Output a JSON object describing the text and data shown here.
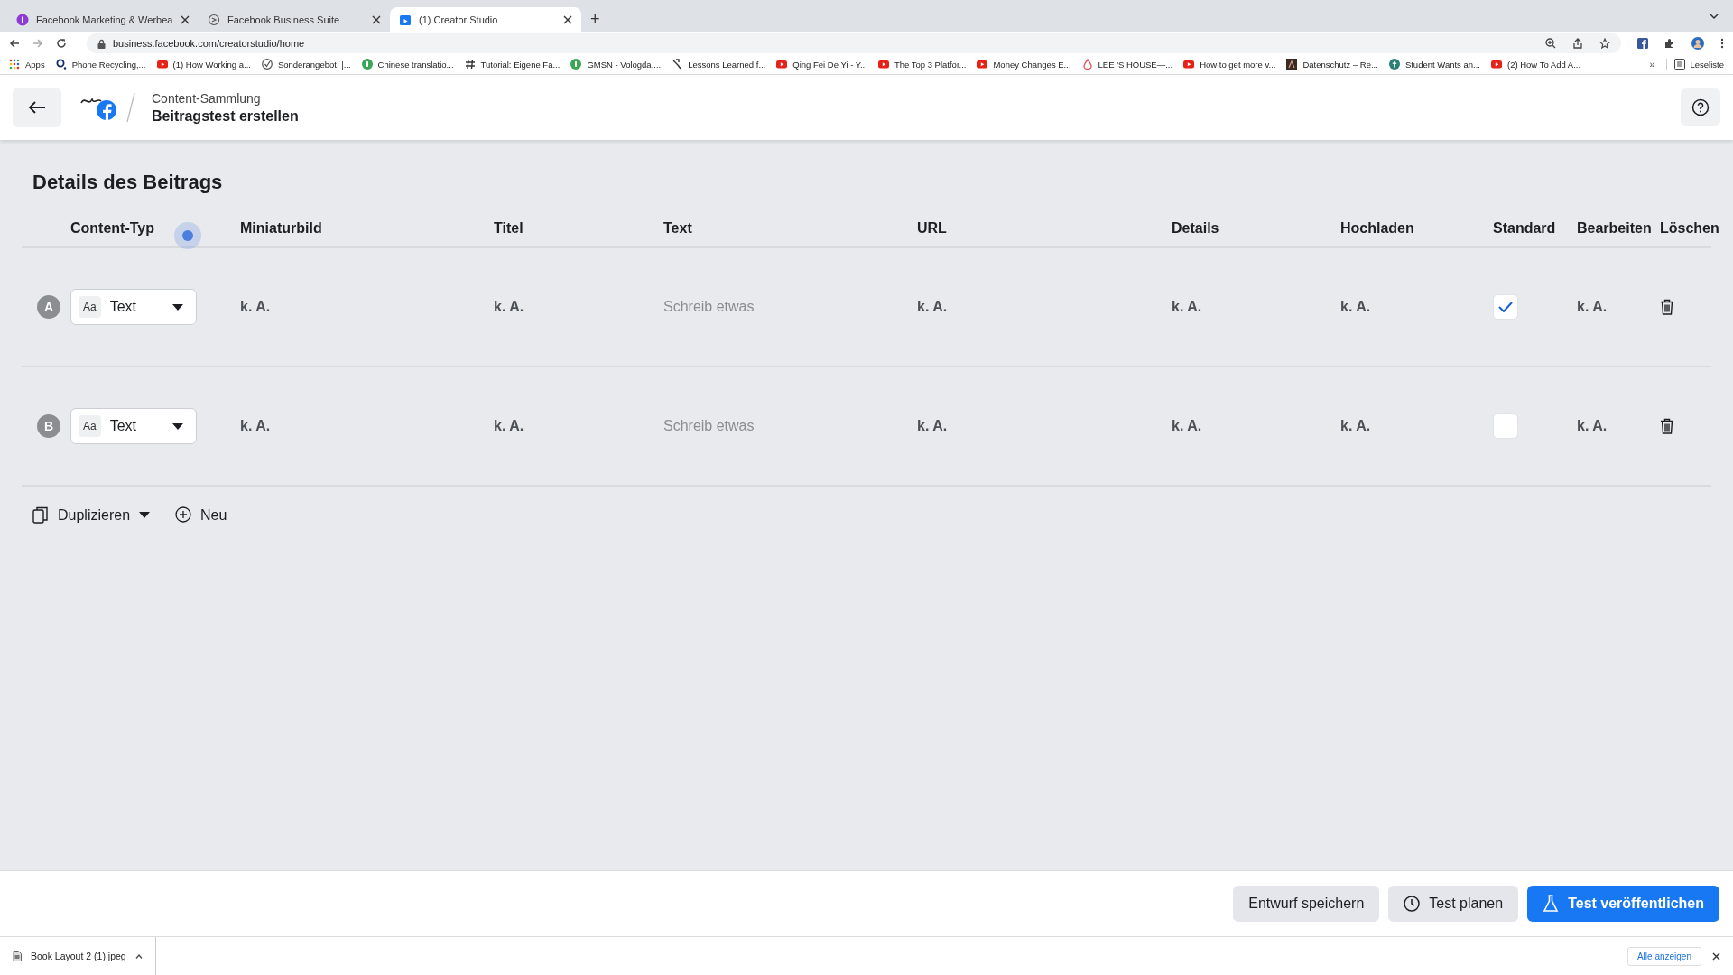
{
  "browser": {
    "tabs": [
      {
        "title": "Facebook Marketing & Werbea",
        "selected": false,
        "kind": "purple"
      },
      {
        "title": "Facebook Business Suite",
        "selected": false,
        "kind": "suite"
      },
      {
        "title": "(1) Creator Studio",
        "selected": true,
        "kind": "studio"
      }
    ],
    "new_tab": "+",
    "address": "business.facebook.com/creatorstudio/home",
    "bookmarks": [
      {
        "title": "Apps",
        "kind": "apps"
      },
      {
        "title": "Phone Recycling,...",
        "kind": "o2"
      },
      {
        "title": "(1) How Working a...",
        "kind": "video"
      },
      {
        "title": "Sonderangebot! |...",
        "kind": "check"
      },
      {
        "title": "Chinese translatio...",
        "kind": "green"
      },
      {
        "title": "Tutorial: Eigene Fa...",
        "kind": "hash"
      },
      {
        "title": "GMSN - Vologda,...",
        "kind": "green"
      },
      {
        "title": "Lessons Learned f...",
        "kind": "tool"
      },
      {
        "title": "Qing Fei De Yi - Y...",
        "kind": "video"
      },
      {
        "title": "The Top 3 Platfor...",
        "kind": "video"
      },
      {
        "title": "Money Changes E...",
        "kind": "video"
      },
      {
        "title": "LEE 'S HOUSE—...",
        "kind": "home"
      },
      {
        "title": "How to get more v...",
        "kind": "video"
      },
      {
        "title": "Datenschutz – Re...",
        "kind": "dark"
      },
      {
        "title": "Student Wants an...",
        "kind": "teal"
      },
      {
        "title": "(2) How To Add A...",
        "kind": "video"
      }
    ],
    "more": "»",
    "reading_list": "Leseliste"
  },
  "header": {
    "breadcrumb": "Content-Sammlung",
    "title": "Beitragstest erstellen"
  },
  "section_title": "Details des Beitrags",
  "table": {
    "columns": [
      "Content-Typ",
      "Miniaturbild",
      "Titel",
      "Text",
      "URL",
      "Details",
      "Hochladen",
      "Standard",
      "Bearbeiten",
      "Löschen"
    ],
    "rows": [
      {
        "label": "A",
        "type_icon": "Aa",
        "type": "Text",
        "miniaturbild": "k. A.",
        "titel": "k. A.",
        "text_placeholder": "Schreib etwas",
        "url": "k. A.",
        "details": "k. A.",
        "hochladen": "k. A.",
        "standard": true,
        "bearbeiten": "k. A."
      },
      {
        "label": "B",
        "type_icon": "Aa",
        "type": "Text",
        "miniaturbild": "k. A.",
        "titel": "k. A.",
        "text_placeholder": "Schreib etwas",
        "url": "k. A.",
        "details": "k. A.",
        "hochladen": "k. A.",
        "standard": false,
        "bearbeiten": "k. A."
      }
    ]
  },
  "actions": [
    {
      "label": "Duplizieren",
      "kind": "duplicate"
    },
    {
      "label": "Neu",
      "kind": "new"
    }
  ],
  "footer_buttons": [
    {
      "label": "Entwurf speichern",
      "kind": "plain"
    },
    {
      "label": "Test planen",
      "kind": "clock"
    },
    {
      "label": "Test veröffentlichen",
      "kind": "primary"
    }
  ],
  "downloads": {
    "file": "Book Layout 2 (1).jpeg",
    "show_all": "Alle anzeigen"
  }
}
